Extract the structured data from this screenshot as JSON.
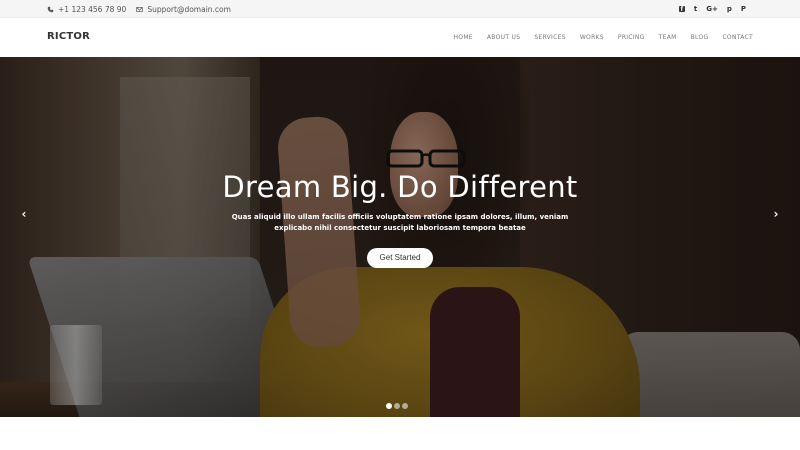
{
  "topbar": {
    "phone": "+1 123 456 78 90",
    "email": "Support@domain.com",
    "social": [
      {
        "icon": "facebook-icon",
        "glyph": "f"
      },
      {
        "icon": "twitter-icon",
        "glyph": "t"
      },
      {
        "icon": "google-plus-icon",
        "glyph": "G+"
      },
      {
        "icon": "pinterest-icon",
        "glyph": "p"
      },
      {
        "icon": "pinterest-p-icon",
        "glyph": "P"
      }
    ]
  },
  "nav": {
    "brand": "RICTOR",
    "items": [
      "HOME",
      "ABOUT US",
      "SERVICES",
      "WORKS",
      "PRICING",
      "TEAM",
      "BLOG",
      "CONTACT"
    ]
  },
  "hero": {
    "title": "Dream Big. Do Different",
    "subtitle": "Quas aliquid illo ullam facilis officiis voluptatem ratione ipsam dolores, illum, veniam explicabo nihil consectetur suscipit laboriosam tempora beatae",
    "cta": "Get Started",
    "prev_arrow": "‹",
    "next_arrow": "›",
    "slides_count": 3,
    "active_slide": 1
  }
}
